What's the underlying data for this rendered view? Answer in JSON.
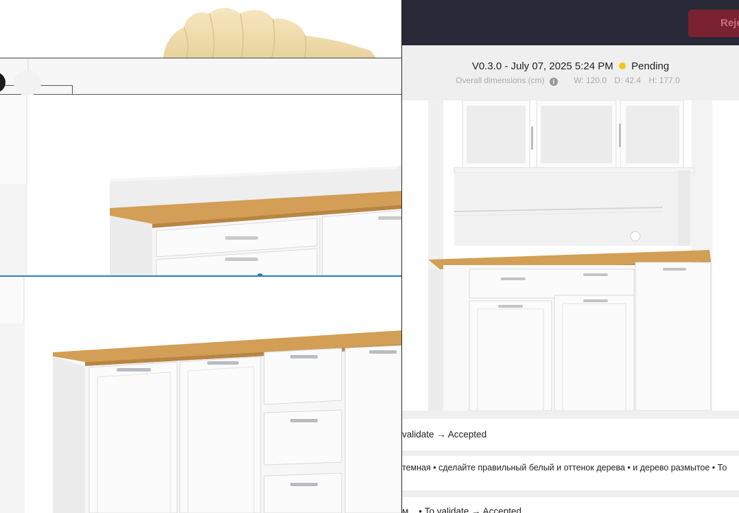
{
  "left_panel": {
    "viewer_top": {
      "label": "3d-preview-upper"
    },
    "viewer_bottom": {
      "label": "3d-preview-lower"
    }
  },
  "right_panel": {
    "topbar": {
      "reject_label": "Reje"
    },
    "version": {
      "title": "V0.3.0 - July 07, 2025 5:24 PM",
      "status": "Pending",
      "status_color": "#f5c518"
    },
    "dimensions": {
      "label": "Overall dimensions (cm)",
      "info_icon": "i",
      "width": "W: 120.0",
      "depth": "D: 42.4",
      "height": "H: 177.0"
    },
    "history": [
      {
        "text": "validate → Accepted"
      },
      {
        "text": "темная • сделайте правильный белый и оттенок дерева • и дерево размытое • То"
      },
      {
        "text": "м... • To validate → Accepted"
      }
    ]
  },
  "colors": {
    "topbar": "#272a36",
    "reject": "#7a2232",
    "split_handle": "#2d7fb8",
    "wood": "#d6a05a",
    "cabinet": "#f4f4f4"
  }
}
